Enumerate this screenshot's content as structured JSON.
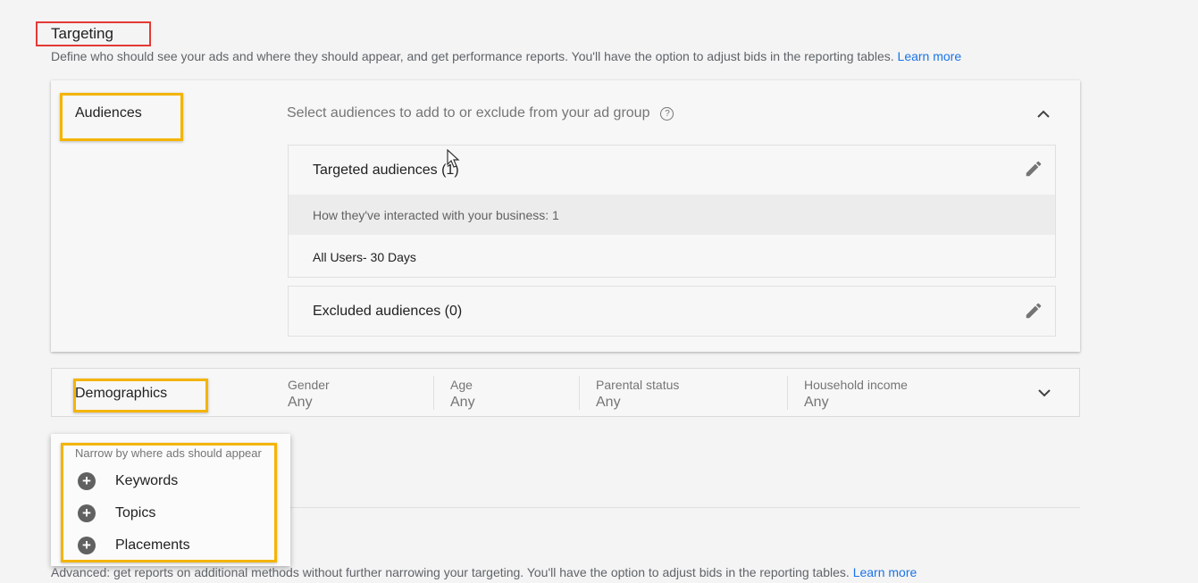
{
  "targeting": {
    "title": "Targeting",
    "description": "Define who should see your ads and where they should appear, and get performance reports. You'll have the option to adjust bids in the reporting tables.",
    "learn_more": "Learn more"
  },
  "audiences": {
    "label": "Audiences",
    "subtitle": "Select audiences to add to or exclude from your ad group",
    "targeted": {
      "title": "Targeted audiences (1)",
      "group_label": "How they've interacted with your business: 1",
      "items": [
        "All Users- 30 Days"
      ]
    },
    "excluded": {
      "title": "Excluded audiences (0)"
    }
  },
  "demographics": {
    "label": "Demographics",
    "columns": [
      {
        "label": "Gender",
        "value": "Any"
      },
      {
        "label": "Age",
        "value": "Any"
      },
      {
        "label": "Parental status",
        "value": "Any"
      },
      {
        "label": "Household income",
        "value": "Any"
      }
    ]
  },
  "narrow_menu": {
    "caption": "Narrow by where ads should appear",
    "items": [
      "Keywords",
      "Topics",
      "Placements"
    ]
  },
  "advanced": {
    "description": "Advanced: get reports on additional methods without further narrowing your targeting. You'll have the option to adjust bids in the reporting tables.",
    "learn_more": "Learn more"
  },
  "colors": {
    "highlight_red": "#e53935",
    "highlight_orange": "#f4b400",
    "link": "#1a73e8"
  },
  "icons": [
    "help-icon",
    "chevron-up-icon",
    "chevron-down-icon",
    "edit-icon",
    "plus-icon",
    "mouse-cursor-icon"
  ]
}
